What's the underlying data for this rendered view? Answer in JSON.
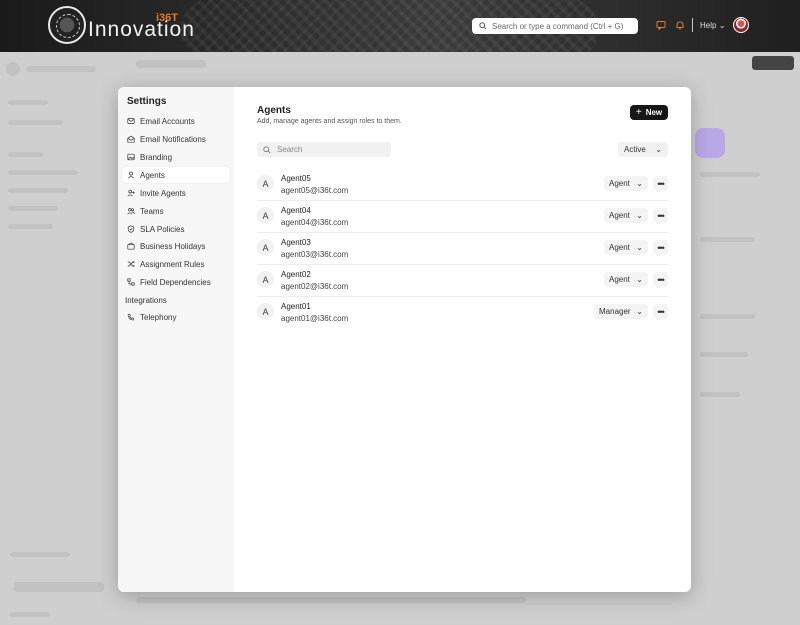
{
  "header": {
    "logo_text": "Innovation",
    "logo_superscript": "i36T",
    "search_placeholder": "Search or type a command (Ctrl + G)",
    "help_label": "Help"
  },
  "settings": {
    "title": "Settings",
    "nav_items": [
      {
        "label": "Email Accounts",
        "icon": "mail-icon"
      },
      {
        "label": "Email Notifications",
        "icon": "envelope-open-icon"
      },
      {
        "label": "Branding",
        "icon": "image-icon"
      },
      {
        "label": "Agents",
        "icon": "user-icon"
      },
      {
        "label": "Invite Agents",
        "icon": "user-plus-icon"
      },
      {
        "label": "Teams",
        "icon": "users-icon"
      },
      {
        "label": "SLA Policies",
        "icon": "shield-icon"
      },
      {
        "label": "Business Holidays",
        "icon": "briefcase-icon"
      },
      {
        "label": "Assignment Rules",
        "icon": "shuffle-icon"
      },
      {
        "label": "Field Dependencies",
        "icon": "flow-icon"
      }
    ],
    "section_integrations": "Integrations",
    "integrations_items": [
      {
        "label": "Telephony",
        "icon": "phone-icon"
      }
    ]
  },
  "agents": {
    "title": "Agents",
    "subtitle": "Add, manage agents and assign roles to them.",
    "new_label": "New",
    "search_placeholder": "Search",
    "status_filter": "Active",
    "list": [
      {
        "initial": "A",
        "name": "Agent05",
        "email": "agent05@i36t.com",
        "role": "Agent"
      },
      {
        "initial": "A",
        "name": "Agent04",
        "email": "agent04@i36t.com",
        "role": "Agent"
      },
      {
        "initial": "A",
        "name": "Agent03",
        "email": "agent03@i36t.com",
        "role": "Agent"
      },
      {
        "initial": "A",
        "name": "Agent02",
        "email": "agent02@i36t.com",
        "role": "Agent"
      },
      {
        "initial": "A",
        "name": "Agent01",
        "email": "agent01@i36t.com",
        "role": "Manager"
      }
    ]
  },
  "colors": {
    "accent_orange": "#e07b2c",
    "new_button_bg": "#171717"
  }
}
